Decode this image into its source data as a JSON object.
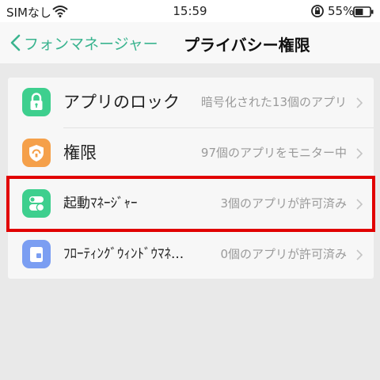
{
  "status_bar": {
    "carrier": "SIMなし",
    "time": "15:59",
    "battery_percent": "55%",
    "battery_level": 0.55,
    "icons": [
      "wifi-icon",
      "rotation-lock-icon",
      "battery-icon"
    ]
  },
  "header": {
    "back_label": "フォンマネージャー",
    "title": "プライバシー権限"
  },
  "settings_list": {
    "items": [
      {
        "title": "アプリのロック",
        "subtitle": "暗号化された13個のアプリ",
        "icon": "lock-icon",
        "color": "#3ecf8e"
      },
      {
        "title": "権限",
        "subtitle": "97個のアプリをモニター中",
        "icon": "shield-icon",
        "color": "#f5a04a"
      },
      {
        "title": "起動ﾏﾈｰｼﾞｬｰ",
        "subtitle": "3個のアプリが許可済み",
        "icon": "toggle-icon",
        "color": "#3ecf8e"
      },
      {
        "title": "ﾌﾛｰﾃｨﾝｸﾞｳｨﾝﾄﾞｳﾏﾈ...",
        "subtitle": "0個のアプリが許可済み",
        "icon": "floating-window-icon",
        "color": "#7b9ef2"
      }
    ]
  },
  "colors": {
    "accent": "#3ab48f",
    "highlight_border": "#e10000",
    "background": "#e9e9e9"
  }
}
